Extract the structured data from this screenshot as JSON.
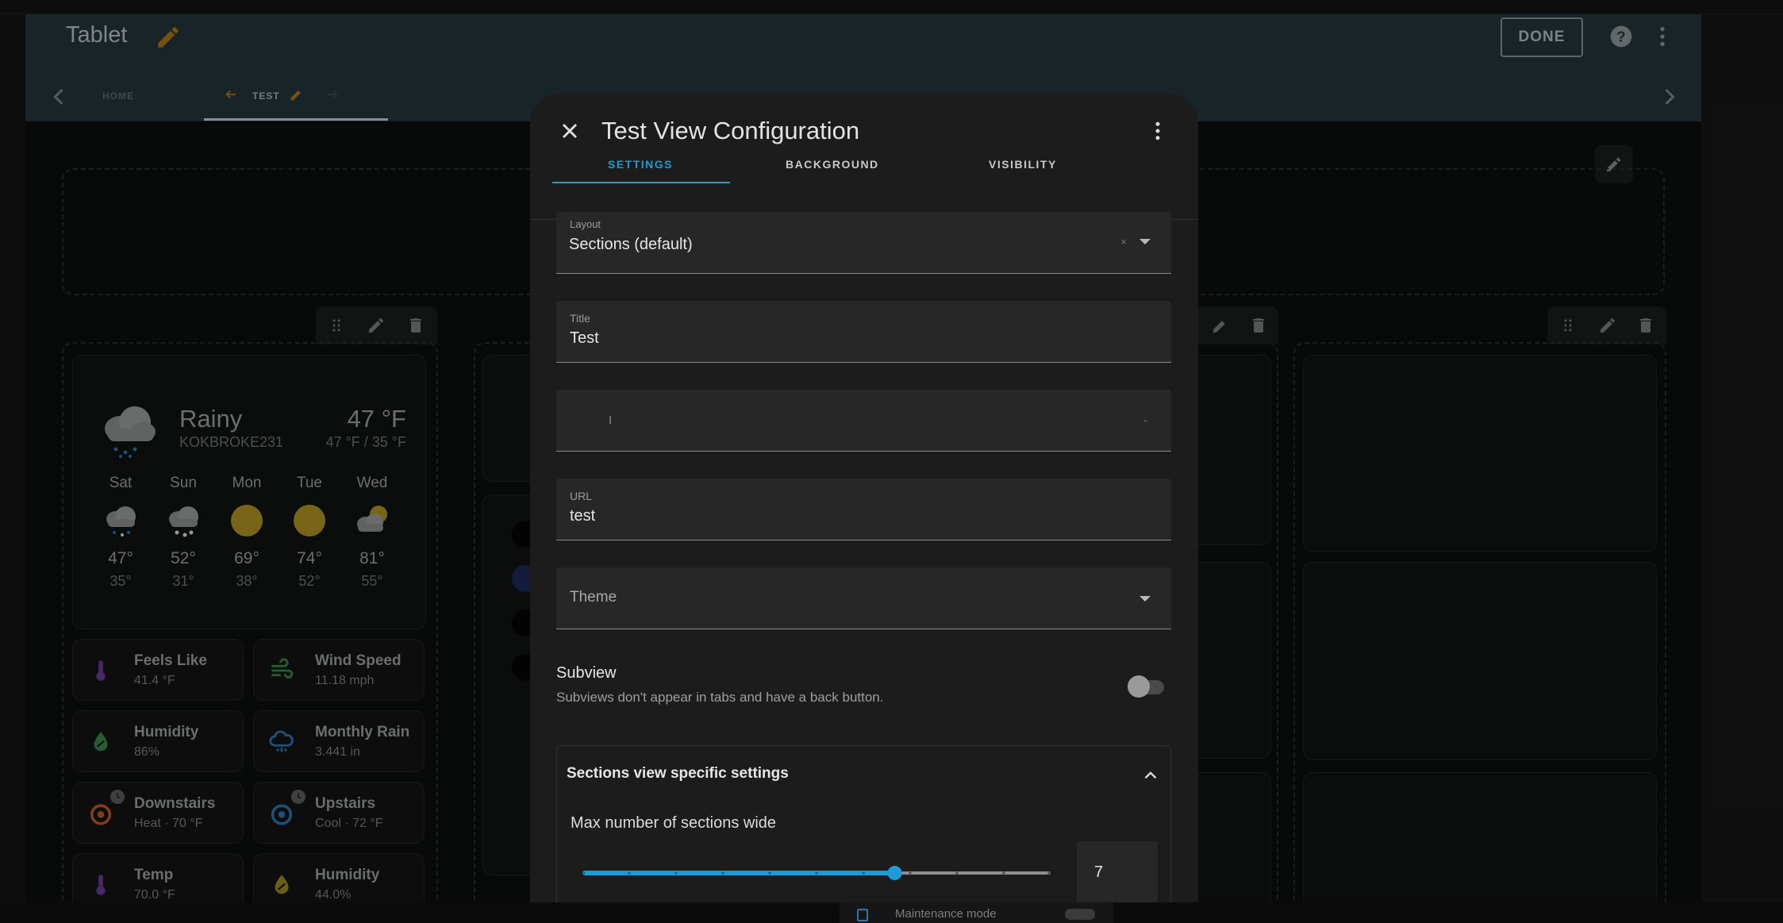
{
  "header": {
    "title": "Tablet",
    "done_label": "DONE"
  },
  "tabs": [
    {
      "label": "HOME"
    },
    {
      "label": "TEST"
    }
  ],
  "weather": {
    "condition": "Rainy",
    "station": "KOKBROKE231",
    "temp": "47 °F",
    "hilo": "47 °F / 35 °F",
    "forecast": [
      {
        "day": "Sat",
        "hi": "47°",
        "lo": "35°",
        "icon": "snow-rain-icon"
      },
      {
        "day": "Sun",
        "hi": "52°",
        "lo": "31°",
        "icon": "snow-icon"
      },
      {
        "day": "Mon",
        "hi": "69°",
        "lo": "38°",
        "icon": "sun-icon"
      },
      {
        "day": "Tue",
        "hi": "74°",
        "lo": "52°",
        "icon": "sun-icon"
      },
      {
        "day": "Wed",
        "hi": "81°",
        "lo": "55°",
        "icon": "partly-cloudy-icon"
      }
    ]
  },
  "tiles": [
    {
      "name": "Feels Like",
      "state": "41.4 °F",
      "icon": "thermometer-icon"
    },
    {
      "name": "Wind Speed",
      "state": "11.18 mph",
      "icon": "wind-icon"
    },
    {
      "name": "Humidity",
      "state": "86%",
      "icon": "water-percent-icon"
    },
    {
      "name": "Monthly Rain",
      "state": "3.441 in",
      "icon": "rain-cloud-icon"
    },
    {
      "name": "Downstairs",
      "state": "Heat · 70 °F",
      "icon": "thermostat-icon"
    },
    {
      "name": "Upstairs",
      "state": "Cool · 72 °F",
      "icon": "thermostat-icon"
    },
    {
      "name": "Temp",
      "state": "70.0 °F",
      "icon": "thermometer-icon"
    },
    {
      "name": "Humidity",
      "state": "44.0%",
      "icon": "water-percent-icon"
    }
  ],
  "dialog": {
    "title": "Test View Configuration",
    "tabs": {
      "settings": "SETTINGS",
      "background": "BACKGROUND",
      "visibility": "VISIBILITY"
    },
    "layout": {
      "label": "Layout",
      "value": "Sections (default)"
    },
    "title_field": {
      "label": "Title",
      "value": "Test"
    },
    "icon_field": {
      "value": "I",
      "trailing": "-"
    },
    "url_field": {
      "label": "URL",
      "value": "test"
    },
    "theme_field": {
      "placeholder": "Theme"
    },
    "subview": {
      "title": "Subview",
      "description": "Subviews don't appear in tabs and have a back button.",
      "enabled": false
    },
    "sections": {
      "title": "Sections view specific settings",
      "max_label": "Max number of sections wide",
      "max_value": "7",
      "slider_fraction": 0.667,
      "slider_ticks": 10
    }
  },
  "footer": {
    "maintenance_label": "Maintenance mode"
  },
  "colors": {
    "accent": "#1e9bd7",
    "toolbar": "#25353c",
    "sun": "#b39624",
    "heat": "#c25a22",
    "cool": "#2a78b3"
  }
}
